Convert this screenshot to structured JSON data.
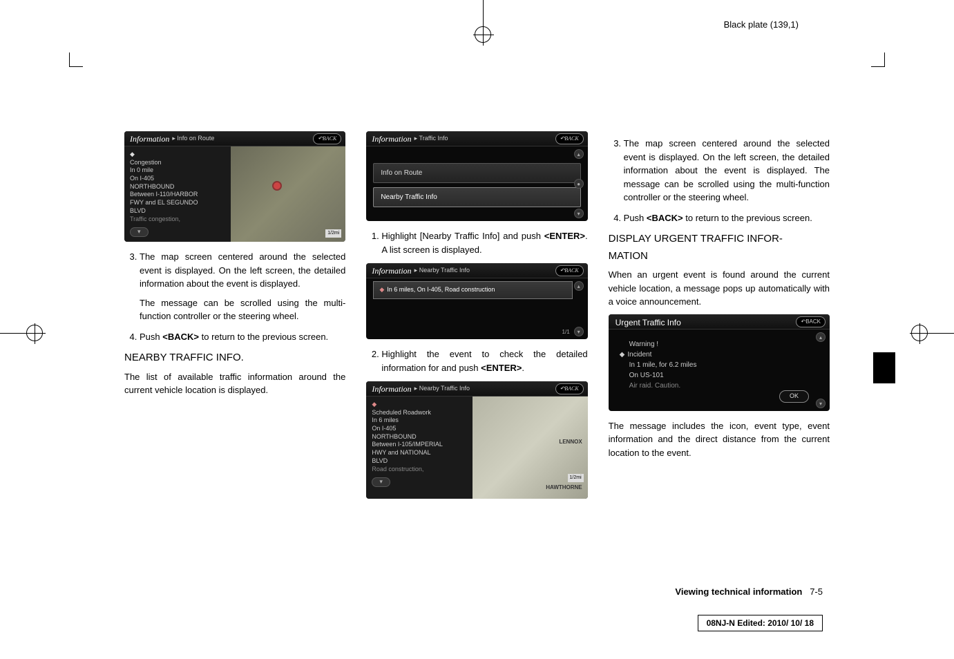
{
  "header": {
    "plate_text": "Black plate (139,1)"
  },
  "crop": {},
  "col1": {
    "ss1": {
      "title": "Information",
      "sub": "▸ Info on Route",
      "back": "↶BACK",
      "lines": {
        "l1": "Congestion",
        "l2": "In 0 mile",
        "l3": "On I-405",
        "l4": "NORTHBOUND",
        "l5": "Between I-110/HARBOR",
        "l6": "FWY and EL SEGUNDO",
        "l7": "BLVD",
        "l8": "Traffic congestion,"
      },
      "scale": "1/2mi"
    },
    "step3": "The map screen centered around the selected event is displayed. On the left screen, the detailed information about the event is displayed.",
    "step3b": "The message can be scrolled using the multi-function controller or the steering wheel.",
    "step4a": "Push ",
    "step4b": "<BACK>",
    "step4c": " to return to the previous screen.",
    "h2": "NEARBY TRAFFIC INFO.",
    "para": "The list of available traffic information around the current vehicle location is displayed."
  },
  "col2": {
    "ss2": {
      "title": "Information",
      "sub": "▸ Traffic Info",
      "back": "↶BACK",
      "row1": "Info on Route",
      "row2": "Nearby Traffic Info"
    },
    "step1a": "Highlight [Nearby Traffic Info] and push ",
    "step1b": "<ENTER>",
    "step1c": ". A list screen is displayed.",
    "ss3": {
      "title": "Information",
      "sub": "▸ Nearby Traffic Info",
      "back": "↶BACK",
      "row": "In 6 miles, On I-405, Road construction",
      "pager": "1/1"
    },
    "step2a": "Highlight the event to check the detailed information for and push ",
    "step2b": "<ENTER>",
    "step2c": ".",
    "ss4": {
      "title": "Information",
      "sub": "▸ Nearby Traffic Info",
      "back": "↶BACK",
      "lines": {
        "l1": "Scheduled Roadwork",
        "l2": "In 6 miles",
        "l3": "On I-405",
        "l4": "NORTHBOUND",
        "l5": "Between I-105/IMPERIAL",
        "l6": "HWY and NATIONAL",
        "l7": "BLVD",
        "l8": "Road construction,"
      },
      "city1": "LENNOX",
      "city2": "HAWTHORNE",
      "scale": "1/2mi"
    }
  },
  "col3": {
    "step3": "The map screen centered around the selected event is displayed. On the left screen, the detailed information about the event is displayed. The message can be scrolled using the multi-function controller or the steering wheel.",
    "step4a": "Push ",
    "step4b": "<BACK>",
    "step4c": " to return to the previous screen.",
    "h3a": "DISPLAY URGENT TRAFFIC INFOR-",
    "h3b": "MATION",
    "para": "When an urgent event is found around the current vehicle location, a message pops up automatically with a voice announcement.",
    "ss5": {
      "title": "Urgent Traffic Info",
      "back": "↶BACK",
      "l1": "Warning !",
      "l2": "Incident",
      "l3": "In 1 mile, for 6.2 miles",
      "l4": "On US-101",
      "l5": "Air raid. Caution.",
      "ok": "OK"
    },
    "para2": "The message includes the icon, event type, event information and the direct distance from the current location to the event."
  },
  "footer": {
    "section": "Viewing technical information",
    "page": "7-5",
    "edit": "08NJ-N Edited: 2010/ 10/ 18"
  }
}
